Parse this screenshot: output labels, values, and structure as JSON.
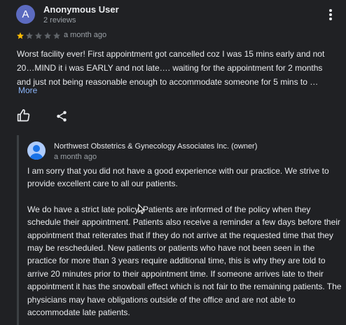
{
  "review": {
    "avatar_letter": "A",
    "user_name": "Anonymous User",
    "user_meta": "2 reviews",
    "rating": 1,
    "rating_max": 5,
    "time": "a month ago",
    "text": "Worst facility ever! First appointment got cancelled coz I was 15 mins early and not 20…MIND it i was EARLY and not late…. waiting for the appointment for 2 months and just not being reasonable enough to accommodate someone for 5 mins to …",
    "more_label": "More",
    "icons": {
      "menu": "more-vert-icon",
      "like": "thumb-up-icon",
      "share": "share-icon"
    }
  },
  "owner_response": {
    "name": "Northwest Obstetrics & Gynecology Associates Inc. (owner)",
    "time": "a month ago",
    "paragraphs": [
      "I am sorry that you did not have a good experience with our practice. We strive to provide excellent care to all our patients.",
      "We do have a strict late policy. Patients are informed of the policy when they schedule their appointment. Patients also receive a reminder a few days before their appointment that reiterates that if they do not arrive at the requested time that they may be rescheduled. New patients or patients who have not been seen in the practice for more than 3 years require additional time, this is why they are told to arrive 20 minutes prior to their appointment time. If someone arrives late to their appointment it has the snowball effect which is not fair to the remaining patients. The physicians may have obligations outside of the office and are not able to accommodate late patients."
    ]
  },
  "colors": {
    "background": "#202124",
    "text": "#e8eaed",
    "secondary_text": "#9aa0a6",
    "star_filled": "#fbbc04",
    "star_empty": "#5f6368",
    "link": "#8ab4f8",
    "user_avatar": "#5c6bc0"
  }
}
